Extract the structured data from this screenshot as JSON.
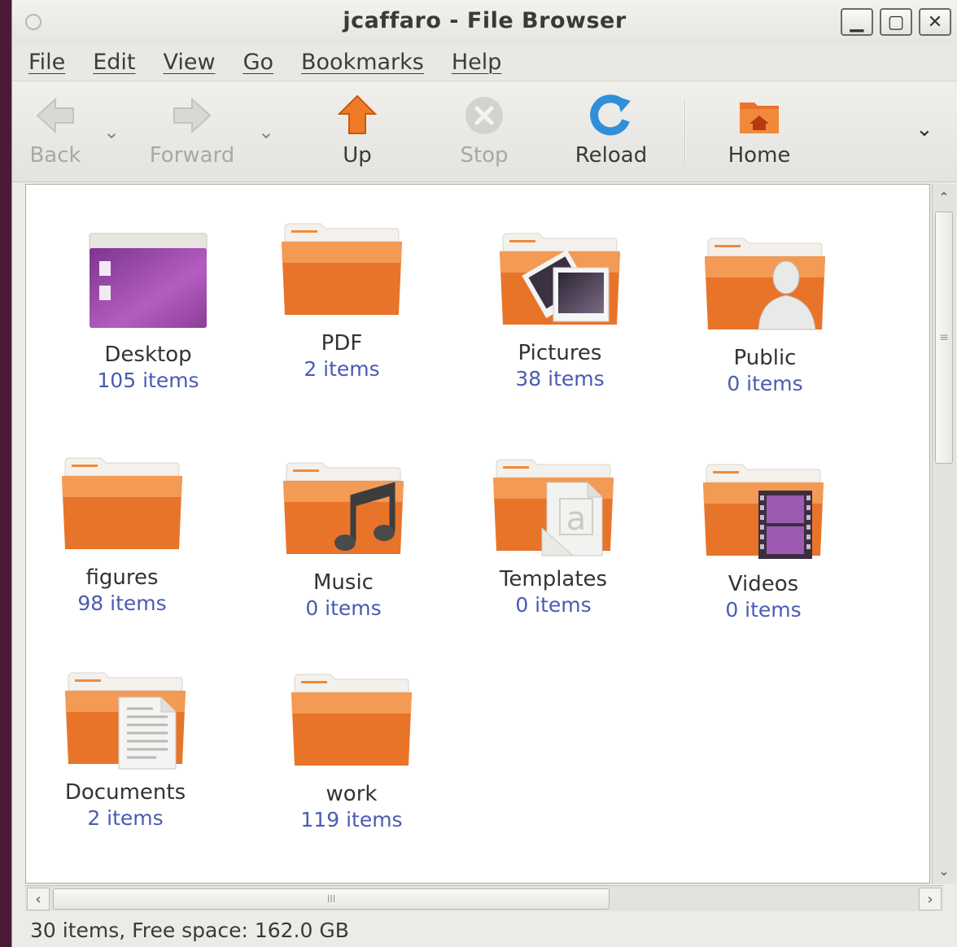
{
  "window": {
    "title": "jcaffaro - File Browser",
    "min_glyph": "▁",
    "max_glyph": "▢",
    "close_glyph": "✕"
  },
  "menu": [
    "File",
    "Edit",
    "View",
    "Go",
    "Bookmarks",
    "Help"
  ],
  "toolbar": {
    "back": "Back",
    "forward": "Forward",
    "up": "Up",
    "stop": "Stop",
    "reload": "Reload",
    "home": "Home",
    "dropdown_glyph": "⌄",
    "more_glyph": "⌄"
  },
  "items": [
    {
      "name": "Desktop",
      "count": "105 items",
      "icon": "desktop-folder-icon"
    },
    {
      "name": "PDF",
      "count": "2 items",
      "icon": "folder-icon"
    },
    {
      "name": "Pictures",
      "count": "38 items",
      "icon": "pictures-folder-icon"
    },
    {
      "name": "Public",
      "count": "0 items",
      "icon": "public-folder-icon"
    },
    {
      "name": "figures",
      "count": "98 items",
      "icon": "folder-icon"
    },
    {
      "name": "Music",
      "count": "0 items",
      "icon": "music-folder-icon"
    },
    {
      "name": "Templates",
      "count": "0 items",
      "icon": "templates-folder-icon"
    },
    {
      "name": "Videos",
      "count": "0 items",
      "icon": "videos-folder-icon"
    },
    {
      "name": "Documents",
      "count": "2 items",
      "icon": "documents-folder-icon"
    },
    {
      "name": "work",
      "count": "119 items",
      "icon": "folder-icon"
    }
  ],
  "scrollbar": {
    "up": "⌃",
    "down": "⌄",
    "left": "‹",
    "right": "›",
    "grip_v": "≡",
    "grip_h": "III"
  },
  "status": "30 items, Free space: 162.0 GB",
  "colors": {
    "folder": "#e8742a",
    "accent_count": "#4a5bb4",
    "desktop": "#8e3d9a"
  }
}
